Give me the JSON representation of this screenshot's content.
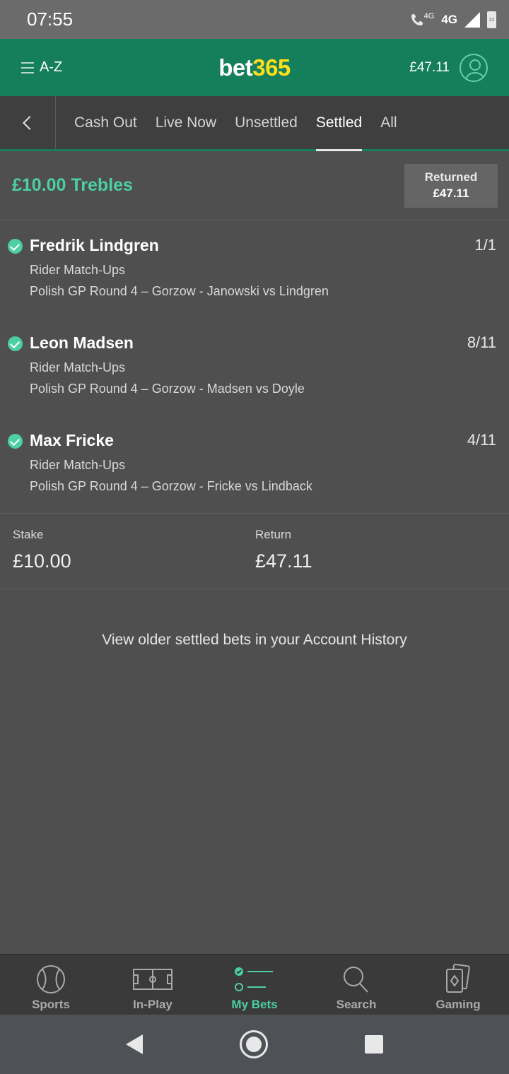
{
  "status": {
    "time": "07:55",
    "net": "4G",
    "net_small": "4G",
    "battery": "32"
  },
  "header": {
    "menu_label": "A-Z",
    "logo_white": "bet",
    "logo_yellow": "365",
    "balance": "£47.11"
  },
  "tabs": [
    {
      "label": "Cash Out"
    },
    {
      "label": "Live Now"
    },
    {
      "label": "Unsettled"
    },
    {
      "label": "Settled",
      "active": true
    },
    {
      "label": "All"
    }
  ],
  "bet": {
    "title": "£10.00 Trebles",
    "returned_label": "Returned",
    "returned_value": "£47.11",
    "selections": [
      {
        "name": "Fredrik Lindgren",
        "odds": "1/1",
        "market": "Rider Match-Ups",
        "event": "Polish GP Round 4 – Gorzow - Janowski vs Lindgren"
      },
      {
        "name": "Leon Madsen",
        "odds": "8/11",
        "market": "Rider Match-Ups",
        "event": "Polish GP Round 4 – Gorzow - Madsen vs Doyle"
      },
      {
        "name": "Max Fricke",
        "odds": "4/11",
        "market": "Rider Match-Ups",
        "event": "Polish GP Round 4 – Gorzow - Fricke vs Lindback"
      }
    ],
    "stake_label": "Stake",
    "stake_value": "£10.00",
    "return_label": "Return",
    "return_value": "£47.11"
  },
  "history_link": "View older settled bets in your Account History",
  "bottom_nav": [
    {
      "label": "Sports",
      "icon": "ball-icon"
    },
    {
      "label": "In-Play",
      "icon": "pitch-icon"
    },
    {
      "label": "My Bets",
      "icon": "bets-list-icon",
      "active": true
    },
    {
      "label": "Search",
      "icon": "search-icon"
    },
    {
      "label": "Gaming",
      "icon": "cards-icon"
    }
  ],
  "colors": {
    "brand_green": "#157f5c",
    "accent_green": "#4ccfa1",
    "logo_yellow": "#ffdf1b"
  }
}
